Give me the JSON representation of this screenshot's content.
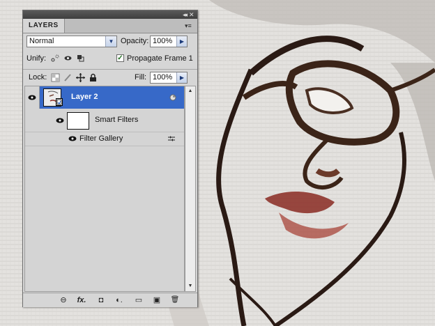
{
  "panel": {
    "tab_label": "LAYERS",
    "collapse_glyph": "◂◂",
    "close_glyph": "✕",
    "menu_glyph": "▾≡",
    "blend_mode": "Normal",
    "opacity_label": "Opacity:",
    "opacity_value": "100%",
    "unify_label": "Unify:",
    "propagate_label": "Propagate Frame 1",
    "propagate_checked": true,
    "lock_label": "Lock:",
    "fill_label": "Fill:",
    "fill_value": "100%"
  },
  "layers": [
    {
      "name": "Layer 2",
      "selected": true,
      "visible": true,
      "smart_object": true
    }
  ],
  "smart_filters": {
    "label": "Smart Filters",
    "filters": [
      {
        "name": "Filter Gallery"
      }
    ]
  },
  "icons": {
    "eye": "eye-icon",
    "link": "link-layers-icon",
    "fx": "fx-icon",
    "mask": "add-mask-icon",
    "adjust": "adjustment-layer-icon",
    "group": "new-group-icon",
    "new_layer": "new-layer-icon",
    "trash": "delete-layer-icon"
  },
  "bottom_bar": {
    "link": "⊖",
    "fx": "fx.",
    "mask": "◘",
    "adjust": "◐.",
    "group": "▭",
    "new_layer": "▣",
    "trash": "🗑"
  },
  "colors": {
    "selection": "#3769c8",
    "panel_bg": "#d6d6d6",
    "title_bar": "#4a4a4a"
  }
}
